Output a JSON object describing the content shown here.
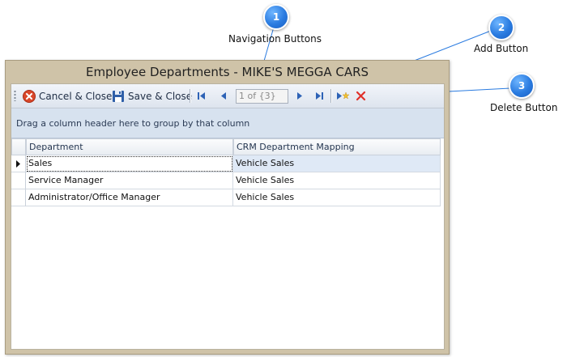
{
  "callouts": [
    {
      "number": "1",
      "label": "Navigation Buttons"
    },
    {
      "number": "2",
      "label": "Add Button"
    },
    {
      "number": "3",
      "label": "Delete Button"
    }
  ],
  "window": {
    "title": "Employee Departments - MIKE'S MEGGA CARS"
  },
  "toolbar": {
    "cancel_label": "Cancel & Close",
    "save_label": "Save & Close",
    "position_text": "1 of {3}"
  },
  "group_panel": {
    "text": "Drag a column header here to group by that column"
  },
  "grid": {
    "columns": [
      "Department",
      "CRM Department Mapping"
    ],
    "rows": [
      {
        "department": "Sales",
        "mapping": "Vehicle Sales"
      },
      {
        "department": "Service Manager",
        "mapping": "Vehicle Sales"
      },
      {
        "department": "Administrator/Office Manager",
        "mapping": "Vehicle Sales"
      }
    ]
  },
  "colors": {
    "callout": "#2a7be0",
    "window_frame": "#cfc3a8",
    "group_panel": "#d7e2ef",
    "selected_row": "#dfe9f6",
    "delete_icon": "#e0302a",
    "cancel_icon": "#d9472b"
  }
}
